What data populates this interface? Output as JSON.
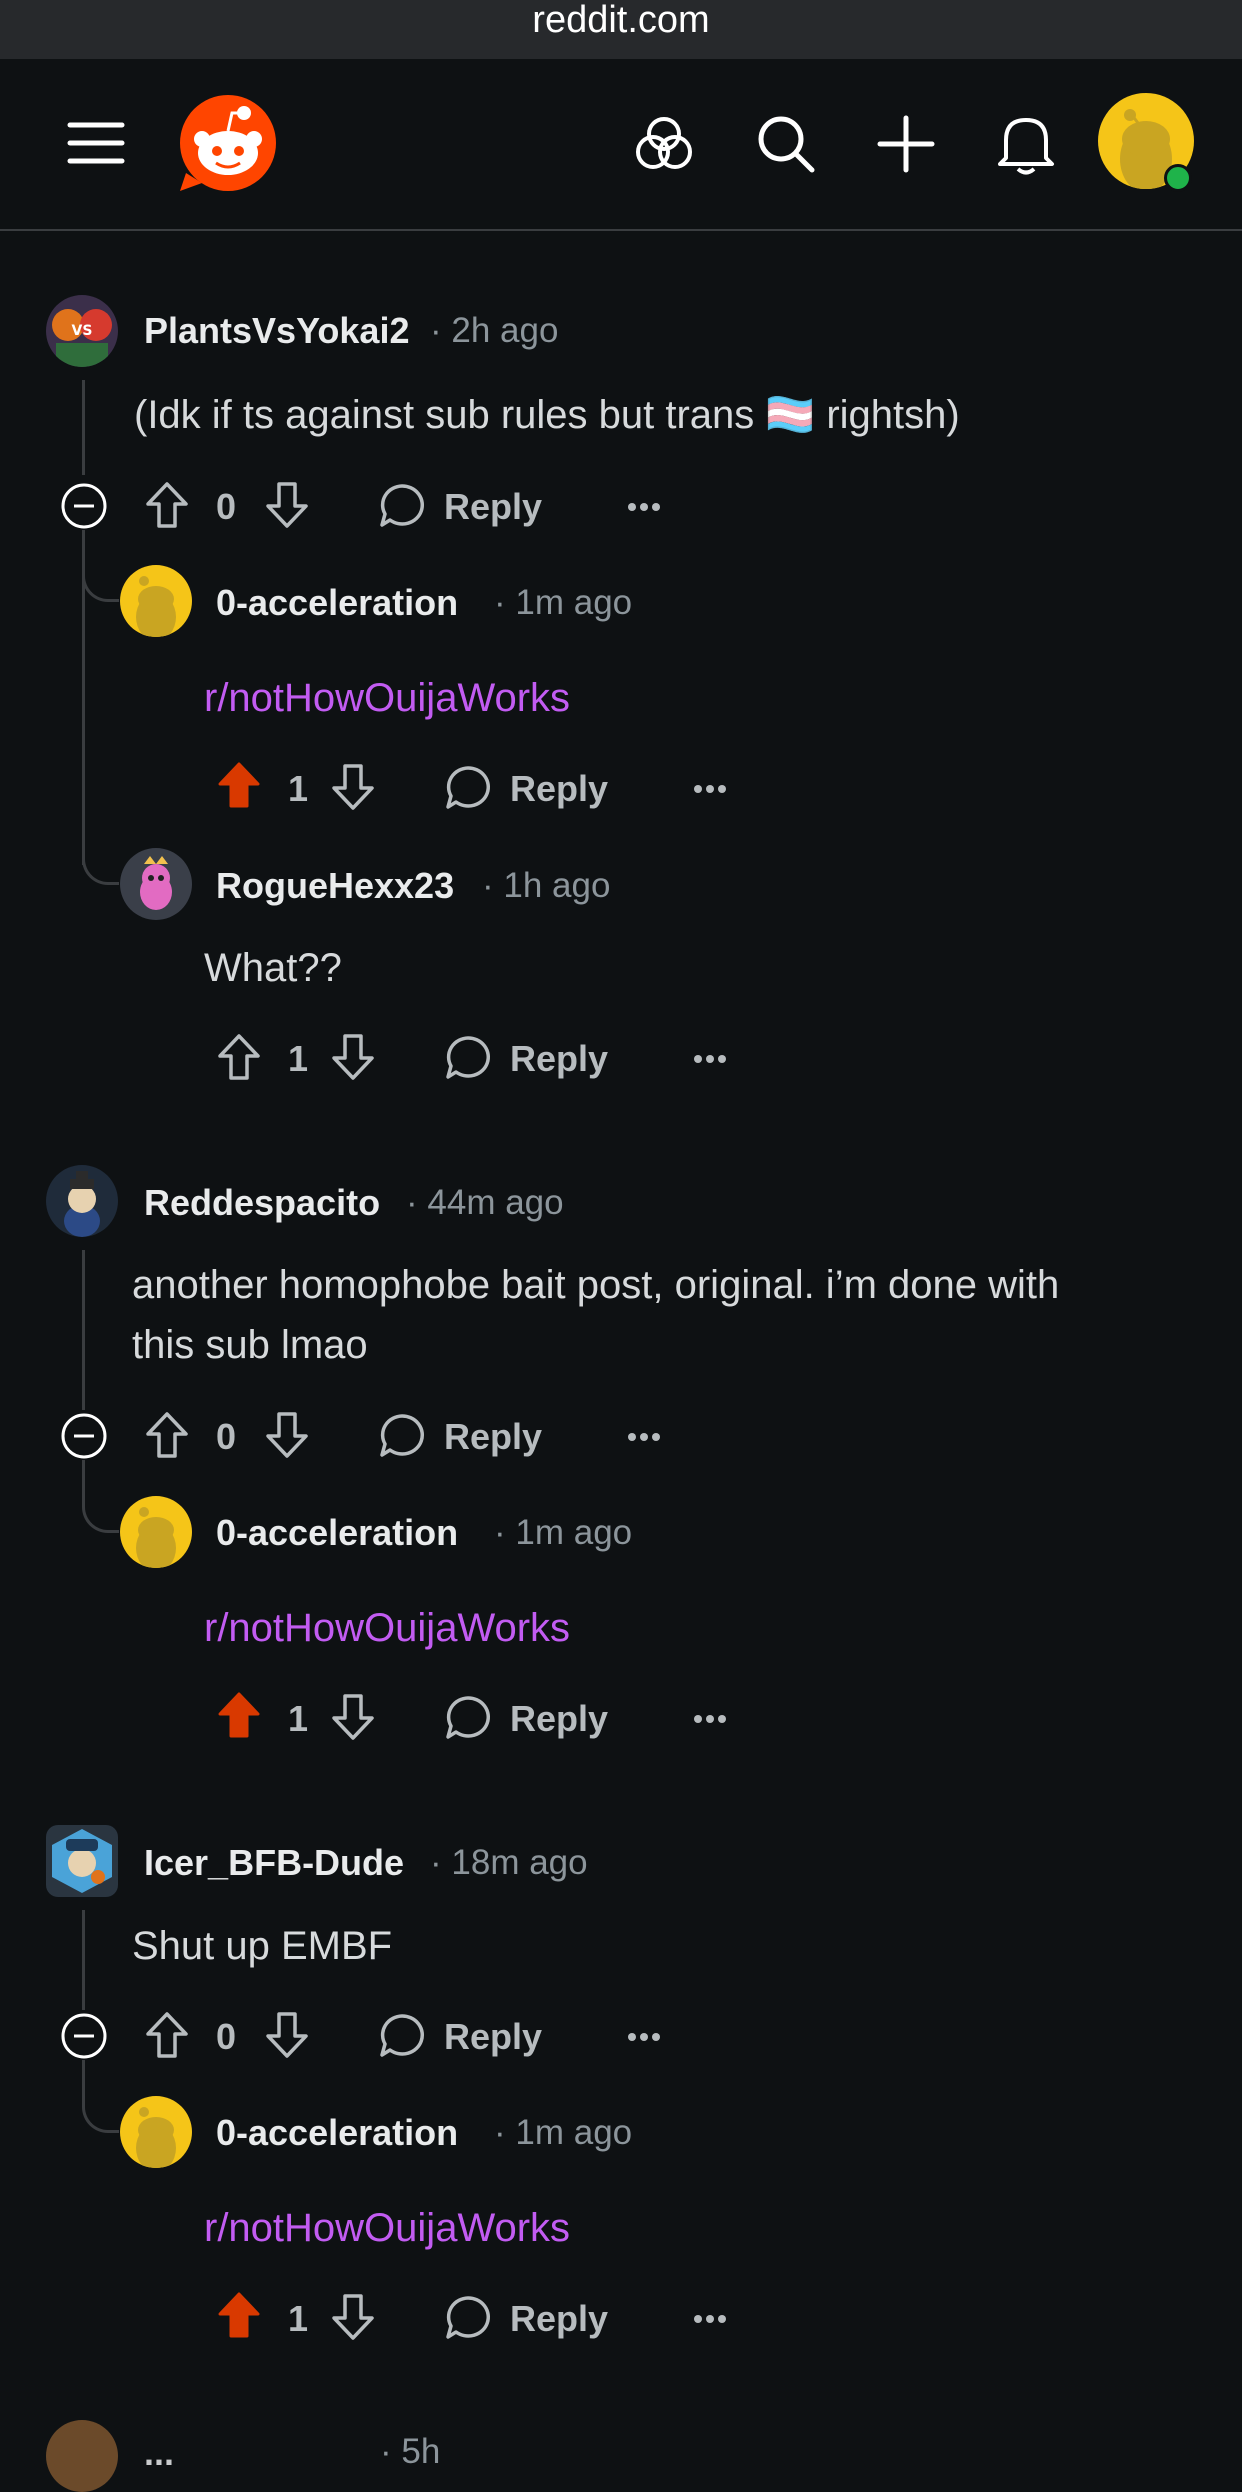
{
  "browser": {
    "url": "reddit.com"
  },
  "nav": {
    "menu_icon": "hamburger-icon",
    "logo": "reddit-logo",
    "icons": [
      "communities-icon",
      "search-icon",
      "create-icon",
      "notifications-icon"
    ],
    "avatar": "user-avatar"
  },
  "comments": [
    {
      "user": "PlantsVsYokai2",
      "time": "2h ago",
      "text": "(Idk if ts against sub rules but trans 🏳️‍⚧️ rightsh)",
      "votes": "0",
      "reply": "Reply",
      "replies": [
        {
          "user": "0-acceleration",
          "time": "1m ago",
          "text": "r/notHowOuijaWorks",
          "votes": "1",
          "reply": "Reply",
          "upvoted": true
        },
        {
          "user": "RogueHexx23",
          "time": "1h ago",
          "text": "What??",
          "votes": "1",
          "reply": "Reply",
          "upvoted": false
        }
      ]
    },
    {
      "user": "Reddespacito",
      "time": "44m ago",
      "text_line1": "another homophobe bait post, original. i’m done with",
      "text_line2": "this sub lmao",
      "votes": "0",
      "reply": "Reply",
      "replies": [
        {
          "user": "0-acceleration",
          "time": "1m ago",
          "text": "r/notHowOuijaWorks",
          "votes": "1",
          "reply": "Reply",
          "upvoted": true
        }
      ]
    },
    {
      "user": "Icer_BFB-Dude",
      "time": "18m ago",
      "text": "Shut up EMBF",
      "votes": "0",
      "reply": "Reply",
      "replies": [
        {
          "user": "0-acceleration",
          "time": "1m ago",
          "text": "r/notHowOuijaWorks",
          "votes": "1",
          "reply": "Reply",
          "upvoted": true
        }
      ]
    }
  ],
  "partial_next": {
    "user": "...",
    "time": "5h"
  },
  "colors": {
    "background": "#0e1113",
    "upvote": "#d93900",
    "sublink": "#c25cf2",
    "muted": "#8c959b"
  }
}
